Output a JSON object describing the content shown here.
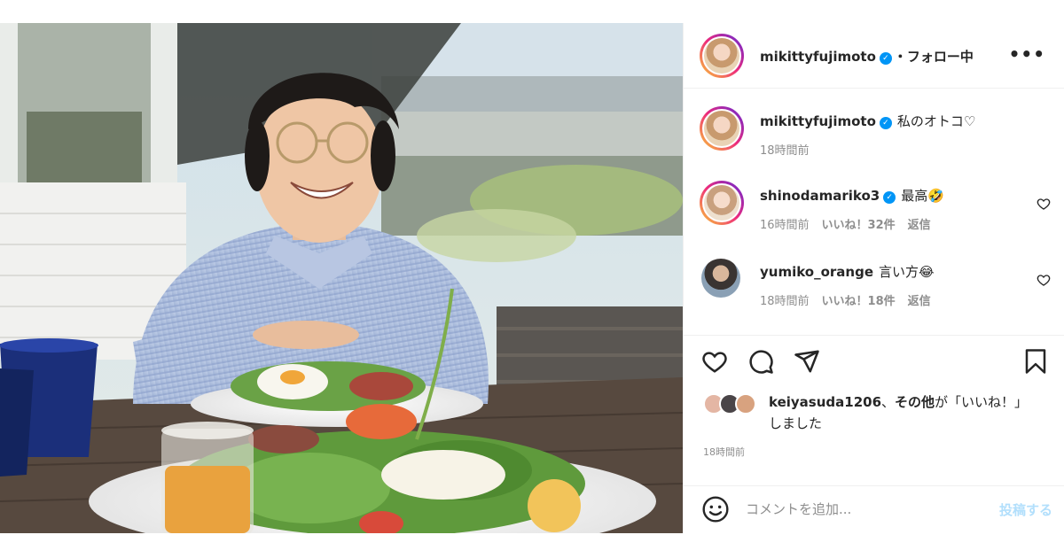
{
  "post": {
    "author": "mikittyfujimoto",
    "follow_status": "・フォロー中",
    "more_icon": "more-horizontal-icon",
    "caption": "私のオトコ♡",
    "caption_time": "18時間前"
  },
  "comments": [
    {
      "user": "shinodamariko3",
      "verified": true,
      "text": "最高🤣",
      "time": "16時間前",
      "likes": "いいね！32件",
      "reply": "返信"
    },
    {
      "user": "yumiko_orange",
      "verified": false,
      "text": "言い方😂",
      "time": "18時間前",
      "likes": "いいね！18件",
      "reply": "返信"
    }
  ],
  "liked_by": {
    "user": "keiyasuda1206",
    "sep": "、",
    "others": "その他",
    "suffix": "が「いいね！」しました"
  },
  "post_time": "18時間前",
  "add_comment": {
    "placeholder": "コメントを追加...",
    "post_label": "投稿する"
  },
  "icons": [
    "heart-icon",
    "comment-icon",
    "share-icon",
    "bookmark-icon",
    "emoji-icon",
    "verified-icon"
  ],
  "colors": {
    "verified": "#0095f6",
    "muted": "#8e8e8e",
    "post_disabled": "#b2dffc",
    "text": "#262626"
  }
}
